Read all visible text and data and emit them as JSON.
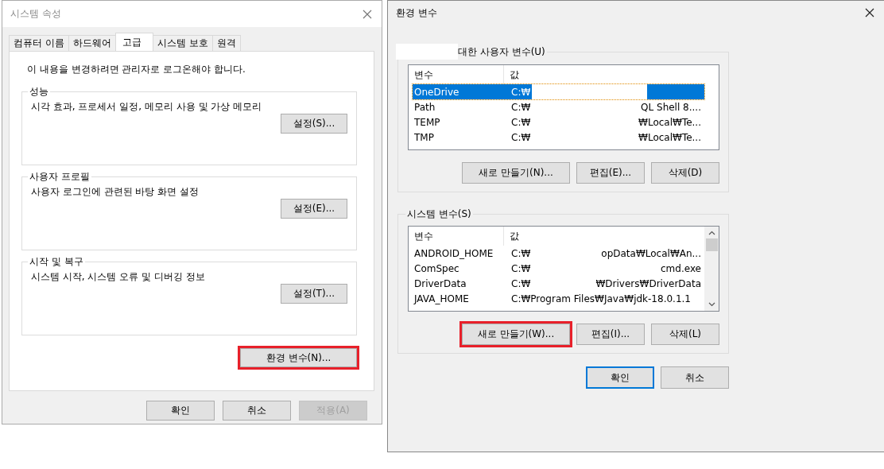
{
  "system_properties": {
    "title": "시스템 속성",
    "tabs": [
      {
        "label": "컴퓨터 이름",
        "selected": false
      },
      {
        "label": "하드웨어",
        "selected": false
      },
      {
        "label": "고급",
        "selected": true
      },
      {
        "label": "시스템 보호",
        "selected": false
      },
      {
        "label": "원격",
        "selected": false
      }
    ],
    "notice": "이 내용을 변경하려면 관리자로 로그온해야 합니다.",
    "groups": [
      {
        "legend": "성능",
        "description": "시각 효과, 프로세서 일정, 메모리 사용 및 가상 메모리",
        "button": "설정(S)..."
      },
      {
        "legend": "사용자 프로필",
        "description": "사용자 로그인에 관련된 바탕 화면 설정",
        "button": "설정(E)..."
      },
      {
        "legend": "시작 및 복구",
        "description": "시스템 시작, 시스템 오류 및 디버깅 정보",
        "button": "설정(T)..."
      }
    ],
    "env_button": {
      "label": "환경 변수(N)...",
      "highlighted": true
    },
    "buttons": [
      {
        "label": "확인",
        "disabled": false
      },
      {
        "label": "취소",
        "disabled": false
      },
      {
        "label": "적용(A)",
        "disabled": true
      }
    ]
  },
  "environment_variables": {
    "title": "환경 변수",
    "user_variables": {
      "legend": "대한 사용자 변수(U)",
      "legend_redacted": true,
      "scrollbar": false,
      "columns": [
        "변수",
        "값"
      ],
      "rows": [
        {
          "name": "OneDrive",
          "value": "C:₩",
          "selected": true,
          "redacted": true
        },
        {
          "name": "Path",
          "value": "C:₩",
          "value_end": "QL Shell 8....",
          "selected": false
        },
        {
          "name": "TEMP",
          "value": "C:₩",
          "value_end": "₩Local₩Te...",
          "selected": false
        },
        {
          "name": "TMP",
          "value": "C:₩",
          "value_end": "₩Local₩Te...",
          "selected": false
        }
      ],
      "buttons": [
        {
          "label": "새로 만들기(N)...",
          "highlighted": false
        },
        {
          "label": "편집(E)...",
          "highlighted": false
        },
        {
          "label": "삭제(D)",
          "highlighted": false
        }
      ]
    },
    "system_variables": {
      "legend": "시스템 변수(S)",
      "scrollbar": true,
      "columns": [
        "변수",
        "값"
      ],
      "rows": [
        {
          "name": "ANDROID_HOME",
          "value": "C:₩",
          "value_end": "opData₩Local₩An...",
          "selected": false
        },
        {
          "name": "ComSpec",
          "value": "C:₩",
          "value_end": "cmd.exe",
          "selected": false
        },
        {
          "name": "DriverData",
          "value": "C:₩",
          "value_end": "₩Drivers₩DriverData",
          "selected": false
        },
        {
          "name": "JAVA_HOME",
          "value": "C:₩Program Files₩Java₩jdk-18.0.1.1",
          "selected": false
        }
      ],
      "buttons": [
        {
          "label": "새로 만들기(W)...",
          "highlighted": true
        },
        {
          "label": "편집(I)...",
          "highlighted": false
        },
        {
          "label": "삭제(L)",
          "highlighted": false
        }
      ]
    },
    "buttons": [
      {
        "label": "확인",
        "default": true
      },
      {
        "label": "취소",
        "default": false
      }
    ]
  }
}
